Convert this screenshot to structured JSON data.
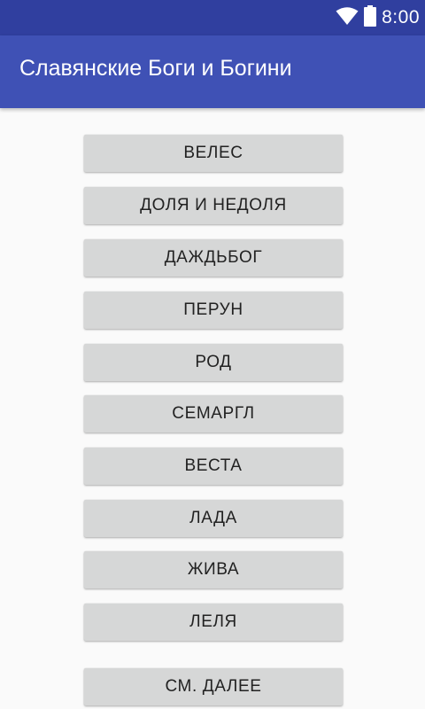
{
  "status_bar": {
    "time": "8:00",
    "icons": [
      "wifi-icon",
      "battery-icon"
    ]
  },
  "app_bar": {
    "title": "Славянские Боги и Богини"
  },
  "buttons": [
    {
      "label": "ВЕЛЕС"
    },
    {
      "label": "ДОЛЯ И НЕДОЛЯ"
    },
    {
      "label": "ДАЖДЬБОГ"
    },
    {
      "label": "ПЕРУН"
    },
    {
      "label": "РОД"
    },
    {
      "label": "СЕМАРГЛ"
    },
    {
      "label": "ВЕСТА"
    },
    {
      "label": "ЛАДА"
    },
    {
      "label": "ЖИВА"
    },
    {
      "label": "ЛЕЛЯ"
    },
    {
      "label": "СМ. ДАЛЕЕ"
    }
  ],
  "colors": {
    "status_bar": "#303f9f",
    "app_bar": "#3f51b5",
    "background": "#fafafa",
    "button": "#d6d7d7",
    "button_text": "#222222"
  }
}
